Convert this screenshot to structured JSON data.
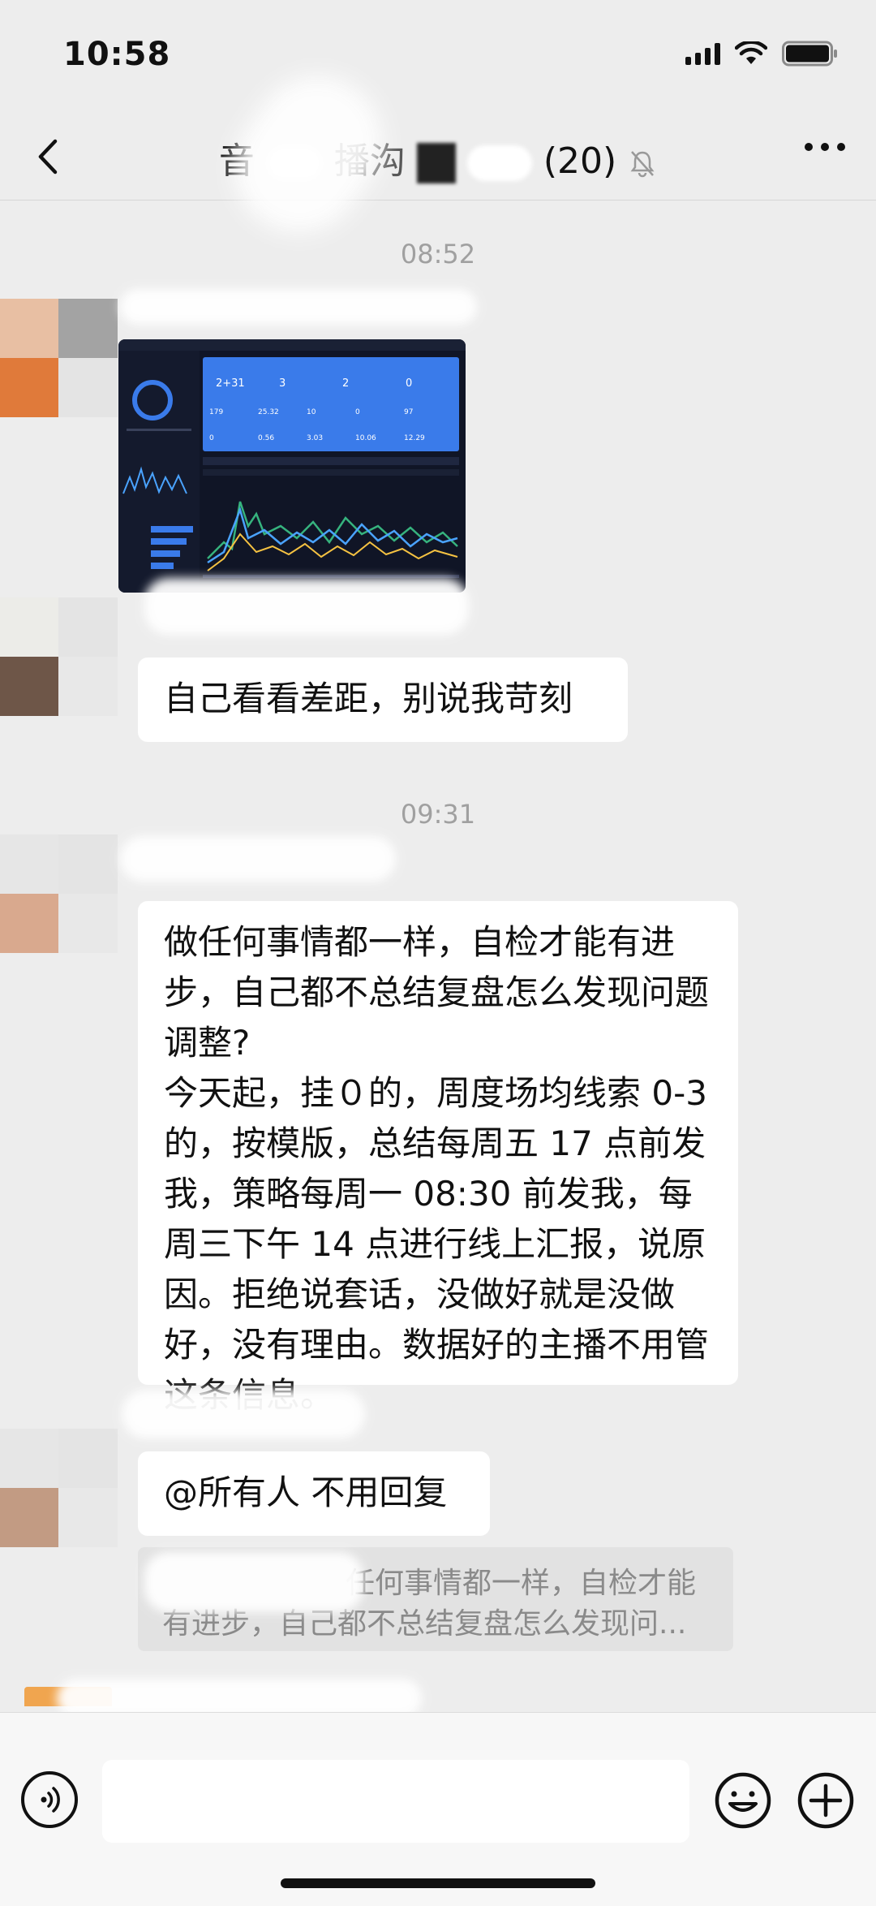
{
  "status_bar": {
    "time": "10:58"
  },
  "nav": {
    "title_left": "音",
    "title_mid": "播沟",
    "member_count": "(20)"
  },
  "messages": {
    "time_1": "08:52",
    "msg_1": "自己看看差距，别说我苛刻",
    "time_2": "09:31",
    "msg_2": "做任何事情都一样，自检才能有进步，自己都不总结复盘怎么发现问题调整?\n今天起，挂０的，周度场均线索 0-3的，按模版，总结每周五 17 点前发我，策略每周一 08:30 前发我，每周三下午 14 点进行线上汇报，说原因。拒绝说套话，没做好就是没做好，没有理由。数据好的主播不用管这条信息。",
    "msg_3": "@所有人 不用回复",
    "quote": "任何事情都一样，自检才能有进步，自己都不总结复盘怎么发现问..."
  },
  "dashboard": {
    "kpis": [
      "2+31",
      "3",
      "2",
      "0"
    ],
    "kpis2": [
      "179",
      "25.32",
      "10",
      "0",
      "97"
    ],
    "kpis3": [
      "0",
      "0.56",
      "3.03",
      "10.06",
      "12.29"
    ]
  },
  "colors": {
    "background": "#ededed",
    "bubble": "#ffffff",
    "time_label": "#a0a0a0",
    "dashboard_bg": "#101526",
    "dashboard_accent": "#3a7bea"
  },
  "icons": [
    "back-icon",
    "mute-bell-icon",
    "more-icon",
    "voice-icon",
    "emoji-icon",
    "plus-icon",
    "signal-icon",
    "wifi-icon",
    "battery-icon"
  ]
}
